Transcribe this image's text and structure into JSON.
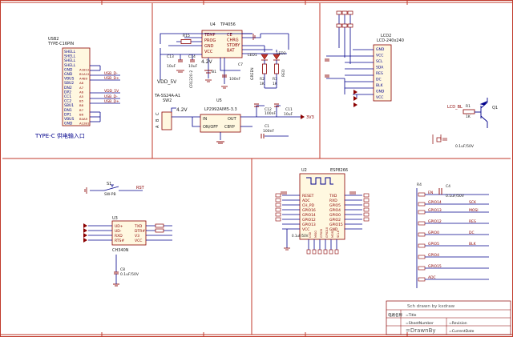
{
  "frame": {
    "border_color": "#c0392b",
    "wire_color": "#00008b",
    "net_color": "#8b0000",
    "label_color": "#1a1a1a"
  },
  "usb": {
    "ref": "USB2",
    "part": "TYPE-C16PIN",
    "pins": [
      "SHELL",
      "SHELL",
      "SHELL",
      "SHELL",
      "GND",
      "GND",
      "VBUS",
      "SBU2",
      "DN2",
      "DP2",
      "CC1",
      "CC2",
      "SBU1",
      "DN1",
      "DP1",
      "VBUS",
      "GND"
    ],
    "pin_nums": [
      "",
      "",
      "",
      "",
      "A1B12",
      "B1A12",
      "A4B9",
      "A8",
      "A7",
      "A6",
      "A5",
      "B5",
      "B8",
      "B7",
      "B6",
      "B4A9",
      "A12B1"
    ],
    "nets": [
      "USB_D-",
      "USB_D+",
      "VDD_5V",
      "USB_D-",
      "USB_D+"
    ],
    "caption": "TYPE-C 供电输入口"
  },
  "charger": {
    "ref": "U4",
    "part": "TP4056",
    "left_pins": [
      "TEMP",
      "PROG",
      "GND",
      "VCC"
    ],
    "right_pins": [
      "CE",
      "CHRG",
      "STDBY",
      "BAT"
    ],
    "r15": "R15",
    "c13": "C13",
    "c13_val": "10uF",
    "c14": "C14",
    "c14_val": "10uF",
    "label_42v": "4.2V",
    "led1": "LED1",
    "led2": "LED2",
    "r2": "R2",
    "r2_val": "1K",
    "r3": "R3",
    "r3_val": "1K",
    "b1": "B1",
    "c7": "C7",
    "c7_val": "100nF",
    "bat": "CR1220-2",
    "green": "GREEN",
    "red": "RED",
    "vdd5v": "VDD_5V"
  },
  "ldo": {
    "ref": "U5",
    "part": "LP2992AIM5-3.3",
    "pins_left": [
      "IN",
      "ON/OFF"
    ],
    "pins_right": [
      "OUT",
      "CBYP"
    ],
    "sw": "TA-SS24A-A1",
    "sw_ref": "SW2",
    "label_42v": "4.2V",
    "c12": "C12",
    "c12_val": "100nF",
    "c11": "C11",
    "c11_val": "10uF",
    "c1": "C1",
    "c1_val": "100nF",
    "net_3v3": "3V3",
    "abc": [
      "A",
      "B",
      "C"
    ]
  },
  "lcd": {
    "ref": "LCD2",
    "part": "LCD-240x240",
    "pins": [
      "GND",
      "VCC",
      "SCL",
      "SDA",
      "RES",
      "DC",
      "BLK",
      "GND",
      "VCC"
    ],
    "net_bl": "LCD_BL",
    "q1": "Q1",
    "r1": "R1",
    "r1_val": "1K",
    "c_val": "0.1uF/50V",
    "nets_left": [
      "SCK",
      "MOSI",
      "RES",
      "DC",
      "LCD_BL"
    ]
  },
  "reset": {
    "ref": "S1",
    "part": "SW-PB",
    "net": "RST"
  },
  "ch340": {
    "ref": "U3",
    "part": "CH340N",
    "left_pins": [
      "UD+",
      "UD-",
      "RXD",
      "RTS#"
    ],
    "right_pins": [
      "TXD",
      "DTR#",
      "V3",
      "VCC"
    ],
    "c8": "C8",
    "c8_val": "0.1uF/50V"
  },
  "esp": {
    "ref": "U2",
    "part": "ESP8266",
    "left_pins": [
      "RESET",
      "ADC",
      "CH_PD",
      "GPIO16",
      "GPIO14",
      "GPIO12",
      "GPIO13",
      "VCC"
    ],
    "right_pins": [
      "TXD",
      "RXD",
      "GPIO5",
      "GPIO4",
      "GPIO0",
      "GPIO2",
      "GPIO15",
      "GND"
    ],
    "bottom_pins": [
      "CS0",
      "MISO",
      "GPIO9",
      "GPIO10",
      "MOSI",
      "SCLK"
    ],
    "cap_val": "0.1uF/50V"
  },
  "io": {
    "r4": "R4",
    "c4": "C4",
    "c4_val": "0.1uF/50V",
    "nets": [
      "EN",
      "GPIO14",
      "GPIO13",
      "GPIO12",
      "GPIO0",
      "GPIO5",
      "GPIO4",
      "GPIO15",
      "ADC"
    ],
    "funcs": [
      "SCK",
      "MOSI",
      "RES",
      "DC",
      "BLK"
    ]
  },
  "titleblock": {
    "drawn": "Sch drawn by kxdraw",
    "row1_label": "电路名称",
    "row1_val": "=Title",
    "row2_val": "=SheetNumber",
    "row3_val": "=DrawnBy",
    "rev_label": "=Revision",
    "date_label": "=CurrentDate"
  }
}
